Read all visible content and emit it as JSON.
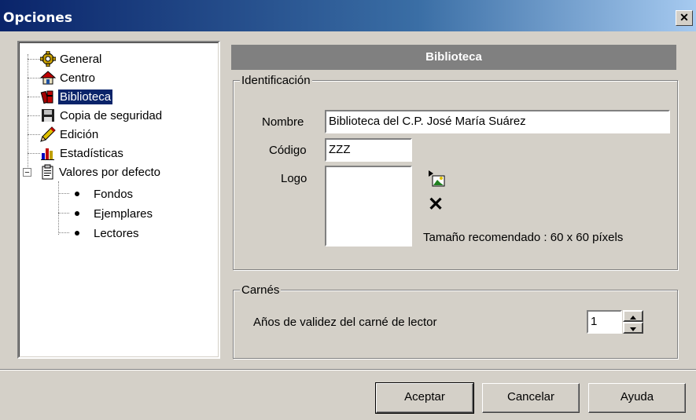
{
  "window": {
    "title": "Opciones",
    "close_glyph": "✕"
  },
  "tree": {
    "items": [
      {
        "label": "General",
        "icon": "gear-icon"
      },
      {
        "label": "Centro",
        "icon": "house-icon"
      },
      {
        "label": "Biblioteca",
        "icon": "books-icon",
        "selected": true
      },
      {
        "label": "Copia de seguridad",
        "icon": "floppy-disk-icon"
      },
      {
        "label": "Edición",
        "icon": "pencil-icon"
      },
      {
        "label": "Estadísticas",
        "icon": "bar-chart-icon"
      },
      {
        "label": "Valores por defecto",
        "icon": "clipboard-icon",
        "expand_glyph": "−"
      }
    ],
    "subitems": [
      {
        "label": "Fondos"
      },
      {
        "label": "Ejemplares"
      },
      {
        "label": "Lectores"
      }
    ]
  },
  "panel": {
    "header": "Biblioteca",
    "identificacion": {
      "title": "Identificación",
      "nombre_label": "Nombre",
      "nombre_value": "Biblioteca del C.P. José María Suárez",
      "codigo_label": "Código",
      "codigo_value": "ZZZ",
      "logo_label": "Logo",
      "load_logo_icon": "load-image-icon",
      "delete_logo_icon": "delete-icon",
      "delete_glyph": "✕",
      "size_hint": "Tamaño recomendado : 60 x 60 píxels"
    },
    "carnes": {
      "title": "Carnés",
      "validez_label": "Años de validez del carné de lector",
      "validez_value": "1"
    }
  },
  "buttons": {
    "ok": "Aceptar",
    "cancel": "Cancelar",
    "help": "Ayuda"
  },
  "colors": {
    "selection": "#0a246a",
    "header_bg": "#808080",
    "face": "#d4d0c8"
  }
}
